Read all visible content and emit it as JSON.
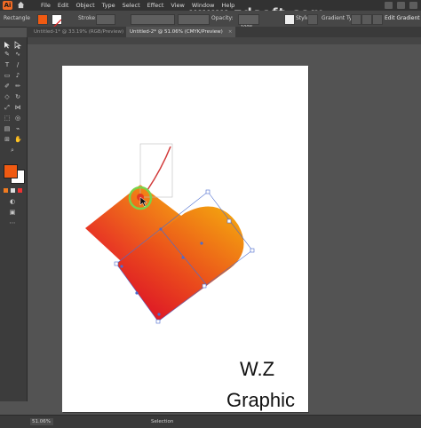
{
  "menubar": {
    "app_logo": "Ai",
    "items": [
      "File",
      "Edit",
      "Object",
      "Type",
      "Select",
      "Effect",
      "View",
      "Window",
      "Help"
    ]
  },
  "watermark": "www.zdsoft.com",
  "controlbar": {
    "selection_label": "Rectangle",
    "stroke_label": "Stroke:",
    "opacity_label": "Opacity:",
    "opacity_value": "100%",
    "style_label": "Style:",
    "gradient_type_label": "Gradient Type:",
    "edit_gradient_label": "Edit Gradient"
  },
  "tabs": [
    {
      "label": "Untitled-1* @ 33.19% (RGB/Preview)",
      "active": false
    },
    {
      "label": "Untitled-2* @ 51.06% (CMYK/Preview)",
      "active": true
    }
  ],
  "colors": {
    "gradient_start": "#f6a70f",
    "gradient_end": "#e3122b",
    "fill_swatch": "#f05a12",
    "highlight_ring": "#7ad24a"
  },
  "artboard_text": {
    "line1": "W.Z",
    "line2": "Graphic"
  },
  "statusbar": {
    "zoom": "51.06%",
    "tool_name": "Selection"
  },
  "toolbar_icons": [
    "selection-icon",
    "direct-selection-icon",
    "pen-icon",
    "curvature-icon",
    "type-icon",
    "line-icon",
    "rectangle-icon",
    "paintbrush-icon",
    "shaper-icon",
    "pencil-icon",
    "eraser-icon",
    "rotate-icon",
    "scale-icon",
    "width-icon",
    "free-transform-icon",
    "shape-builder-icon",
    "perspective-icon",
    "mesh-icon",
    "gradient-icon",
    "eyedropper-icon",
    "blend-icon",
    "symbol-sprayer-icon",
    "column-graph-icon",
    "artboard-icon",
    "slice-icon",
    "hand-icon",
    "zoom-icon"
  ]
}
